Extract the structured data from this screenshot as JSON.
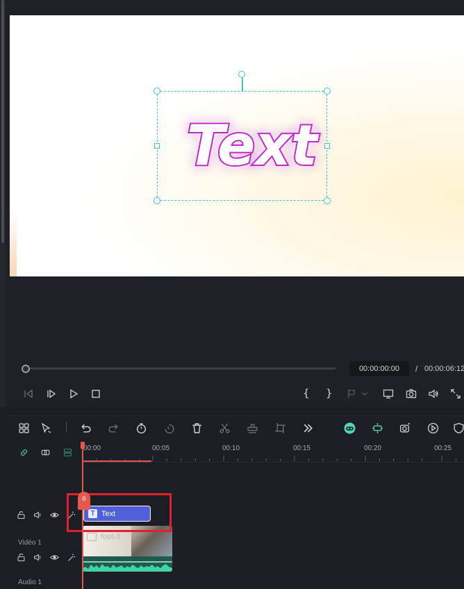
{
  "preview": {
    "canvas_text": "Text",
    "time_current": "00:00:00:00",
    "time_separator": "/",
    "time_total": "00:00:06:12",
    "mark_in": "{",
    "mark_out": "}"
  },
  "timeline": {
    "ruler_ticks": [
      "00:00",
      "00:05",
      "00:10",
      "00:15",
      "00:20",
      "00:25"
    ],
    "playhead_badge": "6",
    "text_clip_label": "Text",
    "text_clip_icon": "T",
    "video_clip_name": "foot-3",
    "tracks": [
      {
        "label": "Vidéo 1"
      },
      {
        "label": "Audio 1"
      }
    ]
  },
  "colors": {
    "accent_teal": "#3ec4c4",
    "playhead_red": "#e8574c",
    "text_clip_blue": "#4e5fd8",
    "highlight_red": "#e0202a",
    "text_glow_magenta": "#e040e0"
  },
  "icons": {
    "toolbar": [
      "grid-icon",
      "select-arrow-icon",
      "undo-icon",
      "redo-icon",
      "speed-icon",
      "ai-speed-icon",
      "delete-icon",
      "split-icon",
      "detach-audio-icon",
      "crop-icon",
      "more-icon",
      "ai-face-icon",
      "ai-stabilize-icon",
      "camera-effects-icon",
      "playback-circle-icon",
      "shield-icon"
    ],
    "playback": [
      "previous-frame-icon",
      "next-frame-icon",
      "play-icon",
      "stop-icon",
      "marker-icon",
      "chevron-down-icon",
      "display-icon",
      "snapshot-icon",
      "volume-icon",
      "fullscreen-icon"
    ]
  }
}
